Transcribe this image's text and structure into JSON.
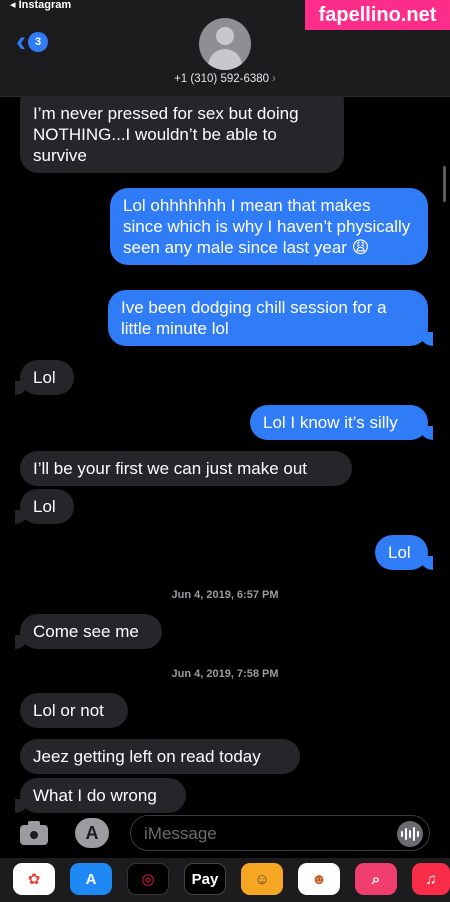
{
  "status": {
    "back_app": "◂ Instagram"
  },
  "watermark": "fapellino.net",
  "header": {
    "unread_count": "3",
    "contact_number": "+1 (310) 592-6380"
  },
  "messages": [
    {
      "text": "I’m never pressed for sex but doing NOTHING...I wouldn’t be able to survive"
    },
    {
      "text": "Lol ohhhhhhh I mean that makes since which is why I haven’t physically seen any male since last year 😩"
    },
    {
      "text": "Ive been dodging chill session for a little minute lol"
    },
    {
      "text": "Lol"
    },
    {
      "text": "Lol I know it’s silly"
    },
    {
      "text": "I’ll be your first we can just make out"
    },
    {
      "text": "Lol"
    },
    {
      "text": "Lol"
    },
    {
      "text": "Come see me"
    },
    {
      "text": "Lol or not"
    },
    {
      "text": "Jeez getting left on read today"
    },
    {
      "text": "What I do wrong"
    }
  ],
  "timestamps": [
    "Jun 4, 2019, 6:57 PM",
    "Jun 4, 2019, 7:58 PM"
  ],
  "input": {
    "placeholder": "iMessage"
  },
  "tray": {
    "applepay_label": "Pay"
  },
  "colors": {
    "sent": "#2f7cf6",
    "received": "#26252a",
    "background": "#000000"
  }
}
